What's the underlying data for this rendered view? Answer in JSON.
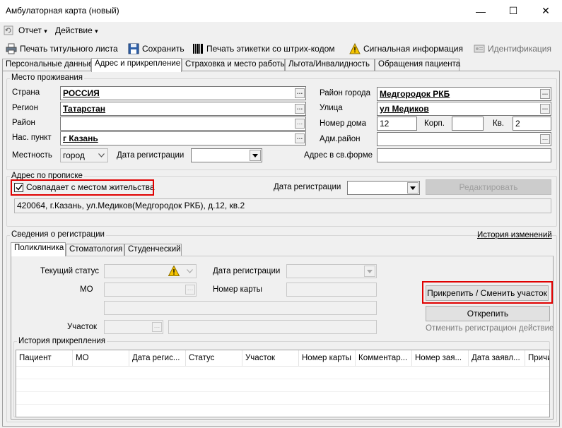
{
  "window": {
    "title": "Амбулаторная карта (новый)",
    "controls": {
      "minimize": "—",
      "maximize": "☐",
      "close": "✕"
    }
  },
  "menu": {
    "items": [
      {
        "label": "Отчет",
        "arrow": "▾"
      },
      {
        "label": "Действие",
        "arrow": "▾"
      }
    ]
  },
  "toolbar": {
    "print_title": "Печать титульного листа",
    "save": "Сохранить",
    "print_barcode": "Печать этикетки со штрих-кодом",
    "signal_info": "Сигнальная информация",
    "identification": "Идентификация"
  },
  "tabs": [
    {
      "label": "Персональные данные",
      "active": false
    },
    {
      "label": "Адрес и прикрепление",
      "active": true
    },
    {
      "label": "Страховка и место работы",
      "active": false
    },
    {
      "label": "Льгота/Инвалидность",
      "active": false
    },
    {
      "label": "Обращения пациента",
      "active": false
    }
  ],
  "residence": {
    "legend": "Место проживания",
    "country_label": "Страна",
    "country_value": "РОССИЯ",
    "region_label": "Регион",
    "region_value": "Татарстан",
    "district_label": "Район",
    "district_value": "",
    "settlement_label": "Нас. пункт",
    "settlement_value": "г Казань",
    "locality_label": "Местность",
    "locality_value": "город",
    "reg_date_label": "Дата регистрации",
    "reg_date_value": "",
    "city_district_label": "Район города",
    "city_district_value": "Медгородок РКБ",
    "street_label": "Улица",
    "street_value": "ул Медиков",
    "house_label": "Номер дома",
    "house_value": "12",
    "building_label": "Корп.",
    "building_value": "",
    "apartment_label": "Кв.",
    "apartment_value": "2",
    "adm_district_label": "Адм.район",
    "adm_district_value": "",
    "free_address_label": "Адрес в св.форме",
    "free_address_value": ""
  },
  "registration_address": {
    "legend": "Адрес по прописке",
    "same_as_residence_label": "Совпадает с местом жительства",
    "same_as_residence_checked": true,
    "reg_date_label": "Дата регистрации",
    "reg_date_value": "",
    "edit_button": "Редактировать",
    "full_address": "420064, г.Казань, ул.Медиков(Медгородок РКБ), д.12, кв.2"
  },
  "registration_info": {
    "legend": "Сведения о регистрации",
    "history_link": "История изменений",
    "subtabs": [
      {
        "label": "Поликлиника",
        "active": true
      },
      {
        "label": "Стоматология",
        "active": false
      },
      {
        "label": "Студенческий",
        "active": false
      }
    ],
    "status_label": "Текущий статус",
    "reg_date_label": "Дата регистрации",
    "mo_label": "МО",
    "card_number_label": "Номер карты",
    "section_label": "Участок",
    "attach_button": "Прикрепить / Сменить участок",
    "detach_button": "Открепить",
    "cancel_registration": "Отменить регистрацион действие"
  },
  "attachment_history": {
    "legend": "История прикрепления",
    "columns": [
      "Пациент",
      "МО",
      "Дата регис...",
      "Статус",
      "Участок",
      "Номер карты",
      "Комментар...",
      "Номер зая...",
      "Дата заявл...",
      "Причи"
    ]
  },
  "colors": {
    "highlight": "#e00000",
    "warning": "#f5c400",
    "background": "#f0f0f0"
  }
}
